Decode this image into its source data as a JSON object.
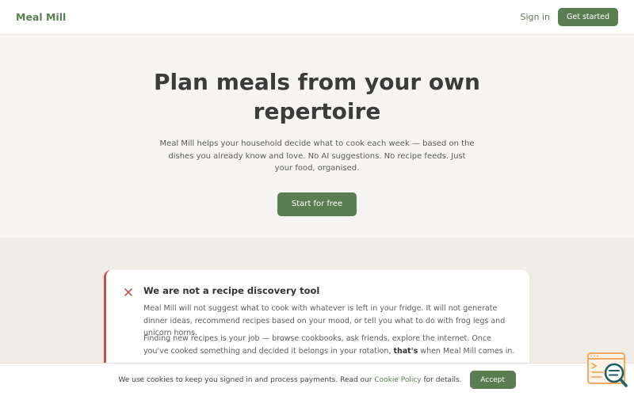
{
  "header": {
    "logo": "Meal Mill",
    "sign_in": "Sign in",
    "get_started": "Get started"
  },
  "hero": {
    "title": "Plan meals from your own repertoire",
    "description": "Meal Mill helps your household decide what to cook each week — based on the dishes you already know and love. No AI suggestions. No recipe feeds. Just your food, organised.",
    "cta": "Start for free"
  },
  "notice": {
    "icon": "x-icon",
    "title": "We are not a recipe discovery tool",
    "paragraph1": "Meal Mill will not suggest what to cook with whatever is left in your fridge. It will not generate dinner ideas, recommend recipes based on your mood, or tell you what to do with frog legs and unicorn horns.",
    "paragraph2_before": "Finding new recipes is your job — browse cookbooks, ask friends, explore the internet. Once you've cooked something and decided it belongs in your rotation,",
    "paragraph2_bold": "that's",
    "paragraph2_after": "when Meal Mill comes in."
  },
  "cookie_banner": {
    "text_before": "We use cookies to keep you signed in and process payments. Read our",
    "link": "Cookie Policy",
    "text_after": "for details.",
    "accept": "Accept"
  },
  "widget": {
    "icon": "search-document-icon"
  },
  "colors": {
    "brand_green": "#5b7d52",
    "notice_red": "#c2524f",
    "page_bg": "#f7f5f1",
    "widget_orange": "#f2a863",
    "widget_teal": "#1f5e63"
  }
}
